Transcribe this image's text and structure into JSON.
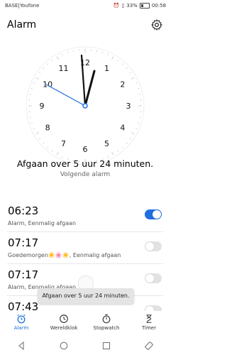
{
  "status": {
    "carrier": "BASE|Youfone",
    "battery": "33%",
    "time": "00:58"
  },
  "header": {
    "title": "Alarm"
  },
  "clock": {
    "numbers": [
      "12",
      "1",
      "2",
      "3",
      "4",
      "5",
      "6",
      "7",
      "8",
      "9",
      "10",
      "11"
    ],
    "accent": "#1f6fe0"
  },
  "next": {
    "time_text": "Afgaan over 5 uur 24 minuten.",
    "label": "Volgende alarm"
  },
  "alarms": [
    {
      "time": "06:23",
      "sub": "Alarm, Eenmalig afgaan",
      "on": true
    },
    {
      "time": "07:17",
      "sub": "Goedemorgen☀️🌸☀️, Eenmalig afgaan",
      "on": false
    },
    {
      "time": "07:17",
      "sub": "Alarm, Eenmalig afgaan",
      "on": false
    },
    {
      "time": "07:43",
      "sub": "",
      "on": false
    }
  ],
  "toast": {
    "text": "Afgaan over 5 uur 24 minuten."
  },
  "tabs": [
    {
      "label": "Alarm",
      "icon": "alarm-icon"
    },
    {
      "label": "Wereldklok",
      "icon": "world-clock-icon"
    },
    {
      "label": "Stopwatch",
      "icon": "stopwatch-icon"
    },
    {
      "label": "Timer",
      "icon": "timer-icon"
    }
  ]
}
